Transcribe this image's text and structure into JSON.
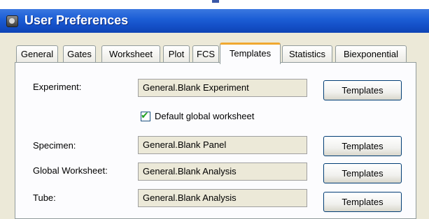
{
  "window": {
    "title": "User Preferences"
  },
  "tabs": [
    {
      "label": "General"
    },
    {
      "label": "Gates"
    },
    {
      "label": "Worksheet"
    },
    {
      "label": "Plot"
    },
    {
      "label": "FCS"
    },
    {
      "label": "Templates",
      "active": true
    },
    {
      "label": "Statistics"
    },
    {
      "label": "Biexponential"
    }
  ],
  "templates": {
    "experiment": {
      "label": "Experiment:",
      "value": "General.Blank Experiment",
      "button": "Templates"
    },
    "default_global_worksheet": {
      "label": "Default global worksheet",
      "checked": true
    },
    "specimen": {
      "label": "Specimen:",
      "value": "General.Blank Panel",
      "button": "Templates"
    },
    "global_worksheet": {
      "label": "Global Worksheet:",
      "value": "General.Blank Analysis",
      "button": "Templates"
    },
    "tube": {
      "label": "Tube:",
      "value": "General.Blank Analysis",
      "button": "Templates"
    }
  },
  "colors": {
    "title_bar": "#1d5fd6",
    "active_tab_accent": "#f0a830",
    "checkbox_check": "#21a121"
  }
}
